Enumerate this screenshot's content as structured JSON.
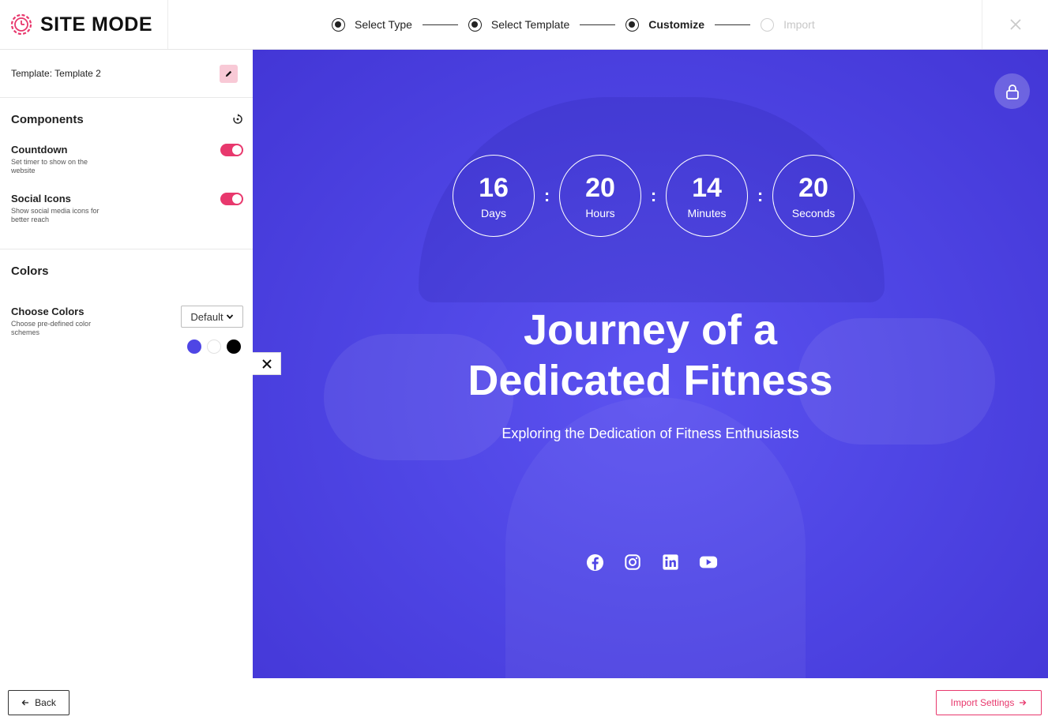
{
  "brand": {
    "name": "SITE MODE",
    "logo_icon": "clock-gear-logo",
    "accent": "#e8386d"
  },
  "steps": [
    {
      "label": "Select Type",
      "state": "done"
    },
    {
      "label": "Select Template",
      "state": "done"
    },
    {
      "label": "Customize",
      "state": "current"
    },
    {
      "label": "Import",
      "state": "inactive"
    }
  ],
  "sidebar": {
    "template_label": "Template: Template 2",
    "components": {
      "title": "Components",
      "items": [
        {
          "title": "Countdown",
          "desc": "Set timer to show on the website",
          "enabled": true
        },
        {
          "title": "Social Icons",
          "desc": "Show social media icons for better reach",
          "enabled": true
        }
      ]
    },
    "colors": {
      "title": "Colors",
      "choose_title": "Choose Colors",
      "choose_desc": "Choose pre-defined color schemes",
      "selected": "Default",
      "swatches": [
        "#4f46e5",
        "#ffffff",
        "#000000"
      ]
    }
  },
  "preview": {
    "background": "#4f46e5",
    "countdown": [
      {
        "value": "16",
        "unit": "Days"
      },
      {
        "value": "20",
        "unit": "Hours"
      },
      {
        "value": "14",
        "unit": "Minutes"
      },
      {
        "value": "20",
        "unit": "Seconds"
      }
    ],
    "separator": ":",
    "headline_line1": "Journey of a",
    "headline_line2": "Dedicated Fitness",
    "subheadline": "Exploring the Dedication of Fitness Enthusiasts",
    "socials": [
      "facebook-icon",
      "instagram-icon",
      "linkedin-icon",
      "youtube-icon"
    ]
  },
  "footer": {
    "back_label": "Back",
    "import_label": "Import Settings"
  }
}
